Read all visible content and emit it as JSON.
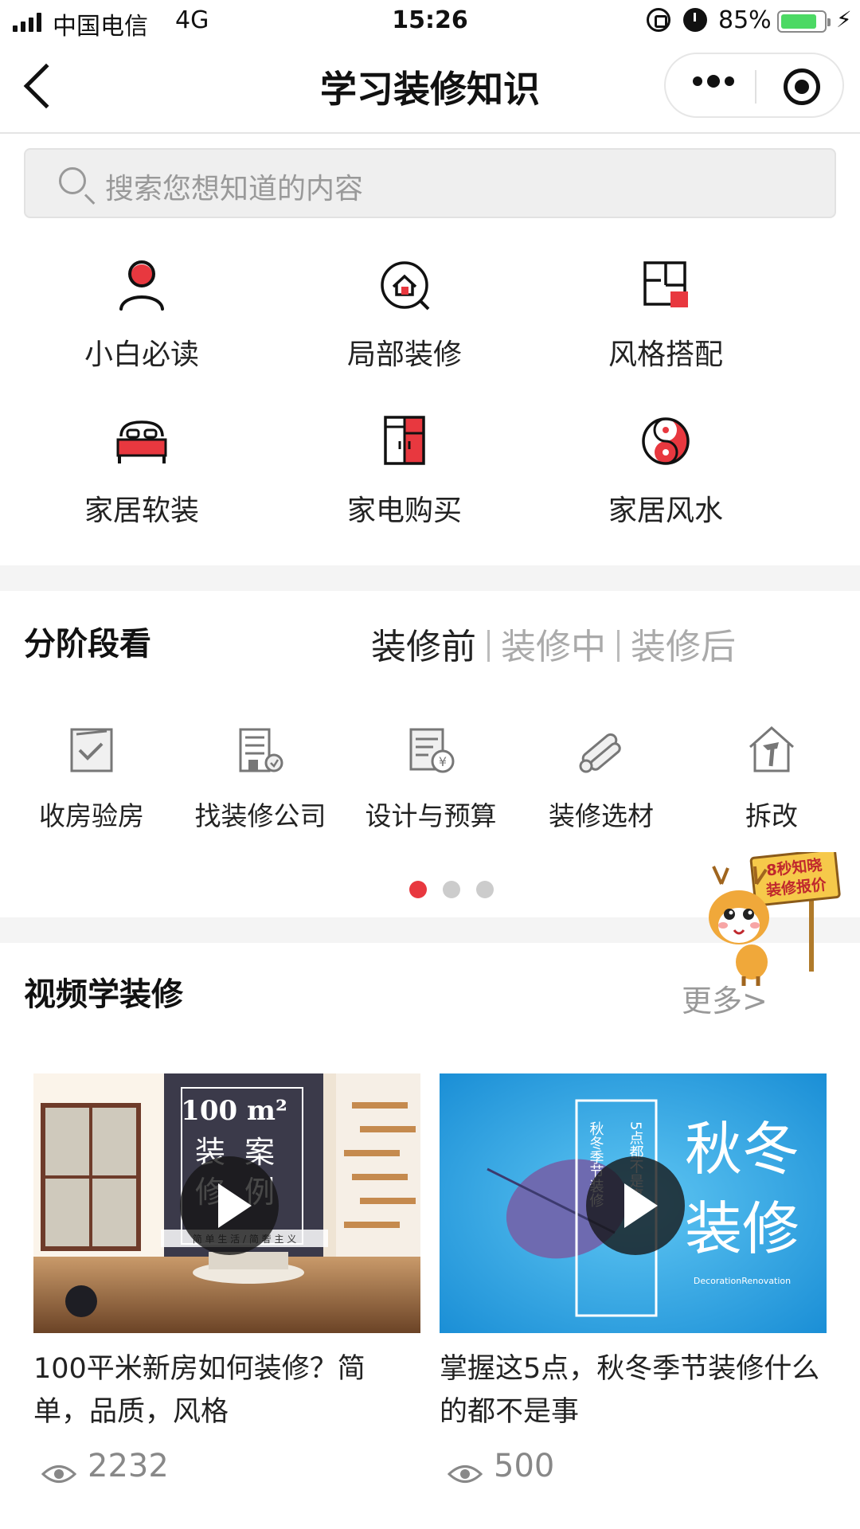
{
  "status_bar": {
    "carrier": "中国电信",
    "network": "4G",
    "time": "15:26",
    "battery_percent": "85%",
    "battery_level": 0.85
  },
  "nav": {
    "title": "学习装修知识",
    "icons": [
      "back-icon",
      "more-icon",
      "target-icon"
    ]
  },
  "search": {
    "placeholder": "搜索您想知道的内容"
  },
  "categories": [
    {
      "label": "小白必读",
      "icon": "user-icon"
    },
    {
      "label": "局部装修",
      "icon": "house-icon"
    },
    {
      "label": "风格搭配",
      "icon": "floorplan-icon"
    },
    {
      "label": "家居软装",
      "icon": "bed-icon"
    },
    {
      "label": "家电购买",
      "icon": "fridge-icon"
    },
    {
      "label": "家居风水",
      "icon": "yinyang-icon"
    }
  ],
  "stages": {
    "title": "分阶段看",
    "tabs": [
      {
        "label": "装修前",
        "active": true
      },
      {
        "label": "装修中",
        "active": false
      },
      {
        "label": "装修后",
        "active": false
      }
    ],
    "items": [
      {
        "label": "收房验房",
        "icon": "checklist-icon"
      },
      {
        "label": "找装修公司",
        "icon": "company-icon"
      },
      {
        "label": "设计与预算",
        "icon": "budget-icon"
      },
      {
        "label": "装修选材",
        "icon": "materials-icon"
      },
      {
        "label": "拆改",
        "icon": "demolish-icon"
      }
    ],
    "page_count": 3,
    "current_page": 1
  },
  "mascot": {
    "sign_line1": "8秒知晓",
    "sign_line2": "装修报价"
  },
  "videos": {
    "title": "视频学装修",
    "more": "更多>",
    "items": [
      {
        "thumb_text_top": "100 m²",
        "thumb_text_a": "装",
        "thumb_text_b": "案",
        "thumb_text_c": "修",
        "thumb_text_d": "例",
        "thumb_caption": "简 单 生 活 / 简 奢 主 义",
        "title": "100平米新房如何装修？简单，品质，风格",
        "views": "2232"
      },
      {
        "thumb_text_big1": "秋冬",
        "thumb_text_big2": "装修",
        "thumb_text_col1": "秋冬季节装修",
        "thumb_text_col2": "5点都不是事",
        "thumb_caption": "DecorationRenovation",
        "title": "掌握这5点，秋冬季节装修什么的都不是事",
        "views": "500"
      }
    ]
  },
  "colors": {
    "accent": "#e8383f",
    "text": "#222222",
    "muted": "#999999"
  }
}
